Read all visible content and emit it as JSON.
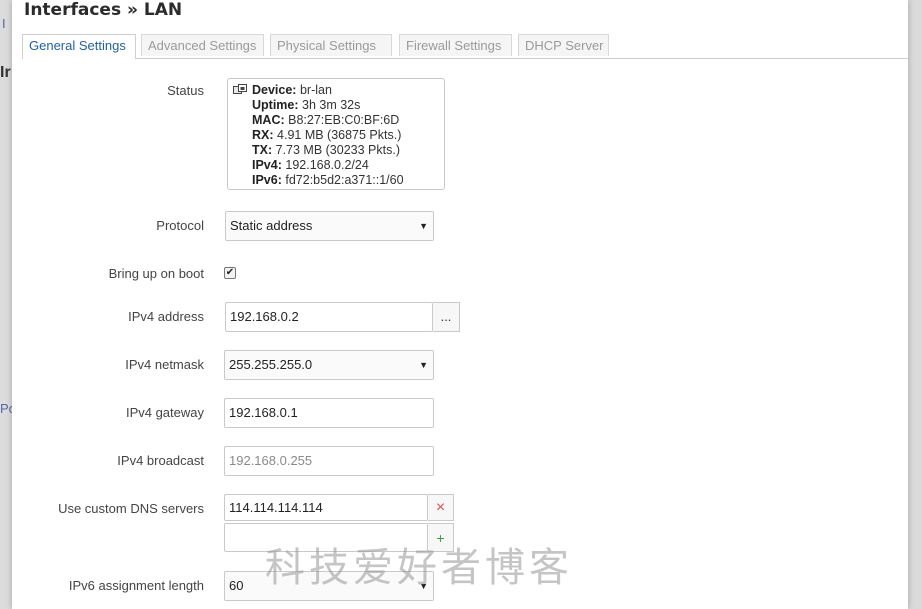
{
  "dialog": {
    "title": "Interfaces » LAN"
  },
  "tabs": [
    {
      "label": "General Settings",
      "active": true
    },
    {
      "label": "Advanced Settings",
      "active": false
    },
    {
      "label": "Physical Settings",
      "active": false
    },
    {
      "label": "Firewall Settings",
      "active": false
    },
    {
      "label": "DHCP Server",
      "active": false
    }
  ],
  "status": {
    "label": "Status",
    "icon": "ethernet-port-icon",
    "rows": [
      {
        "key": "Device:",
        "value": "br-lan"
      },
      {
        "key": "Uptime:",
        "value": "3h 3m 32s"
      },
      {
        "key": "MAC:",
        "value": "B8:27:EB:C0:BF:6D"
      },
      {
        "key": "RX:",
        "value": "4.91 MB (36875 Pkts.)"
      },
      {
        "key": "TX:",
        "value": "7.73 MB (30233 Pkts.)"
      },
      {
        "key": "IPv4:",
        "value": "192.168.0.2/24"
      },
      {
        "key": "IPv6:",
        "value": "fd72:b5d2:a371::1/60"
      }
    ]
  },
  "form": {
    "protocol": {
      "label": "Protocol",
      "value": "Static address"
    },
    "boot": {
      "label": "Bring up on boot",
      "checked": true,
      "mark": "✔"
    },
    "ipv4_address": {
      "label": "IPv4 address",
      "value": "192.168.0.2",
      "more": "..."
    },
    "ipv4_netmask": {
      "label": "IPv4 netmask",
      "value": "255.255.255.0"
    },
    "ipv4_gateway": {
      "label": "IPv4 gateway",
      "value": "192.168.0.1"
    },
    "ipv4_broadcast": {
      "label": "IPv4 broadcast",
      "placeholder": "192.168.0.255"
    },
    "dns": {
      "label": "Use custom DNS servers",
      "value": "114.114.114.114",
      "remove": "×",
      "add": "+",
      "new_value": ""
    },
    "ipv6_assign": {
      "label": "IPv6 assignment length",
      "value": "60"
    }
  },
  "background": {
    "frag1": "I",
    "frag2": "Ir",
    "frag3": "Po"
  },
  "watermark": "科技爱好者博客",
  "colors": {
    "tab_active": "#2660a4",
    "remove": "#d9534f",
    "add": "#3c9a4a"
  }
}
